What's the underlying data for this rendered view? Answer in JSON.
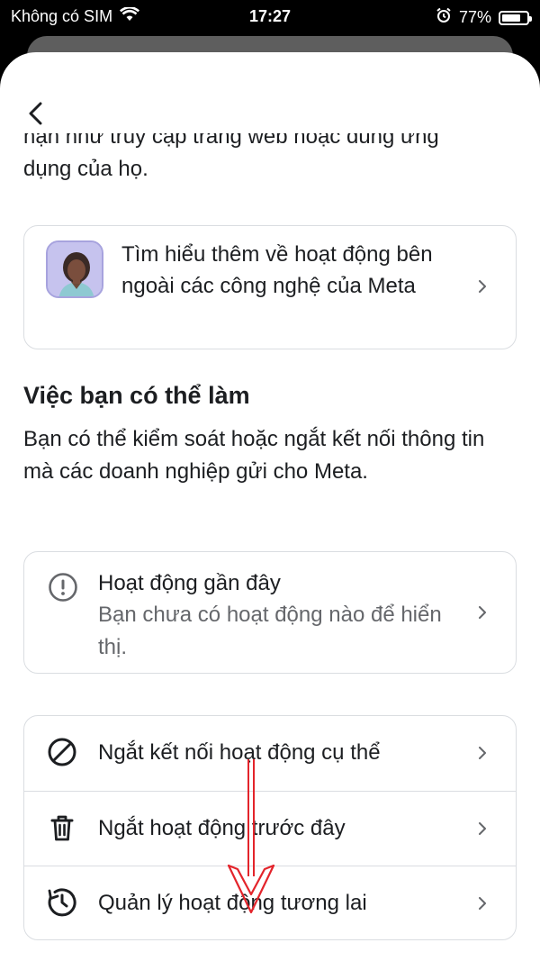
{
  "status_bar": {
    "carrier": "Không có SIM",
    "time": "17:27",
    "battery": "77%",
    "battery_level": 0.77
  },
  "nav": {
    "back_icon": "chevron-left-icon"
  },
  "intro": {
    "top_line": "hạn như truy cập trang web hoặc dùng ứng",
    "continuation": "dụng của họ."
  },
  "learn_more": {
    "label": "Tìm hiểu thêm về hoạt động bên ngoài các công nghệ của Meta",
    "icon": "chevron-right-icon"
  },
  "section": {
    "title": "Việc bạn có thể làm",
    "body": "Bạn có thể kiểm soát hoặc ngắt kết nối thông tin mà các doanh nghiệp gửi cho Meta."
  },
  "recent_activity": {
    "title": "Hoạt động gần đây",
    "subtitle": "Bạn chưa có hoạt động nào để hiển thị.",
    "icon": "info-circle-icon"
  },
  "actions": [
    {
      "label": "Ngắt kết nối hoạt động cụ thể",
      "icon": "block-icon"
    },
    {
      "label": "Ngắt hoạt động trước đây",
      "icon": "trash-icon"
    },
    {
      "label": "Quản lý hoạt động tương lai",
      "icon": "clock-history-icon"
    }
  ],
  "colors": {
    "text": "#1c1e21",
    "secondary": "#65676b",
    "border": "#dadde1",
    "annotation_arrow": "#e3242b"
  }
}
